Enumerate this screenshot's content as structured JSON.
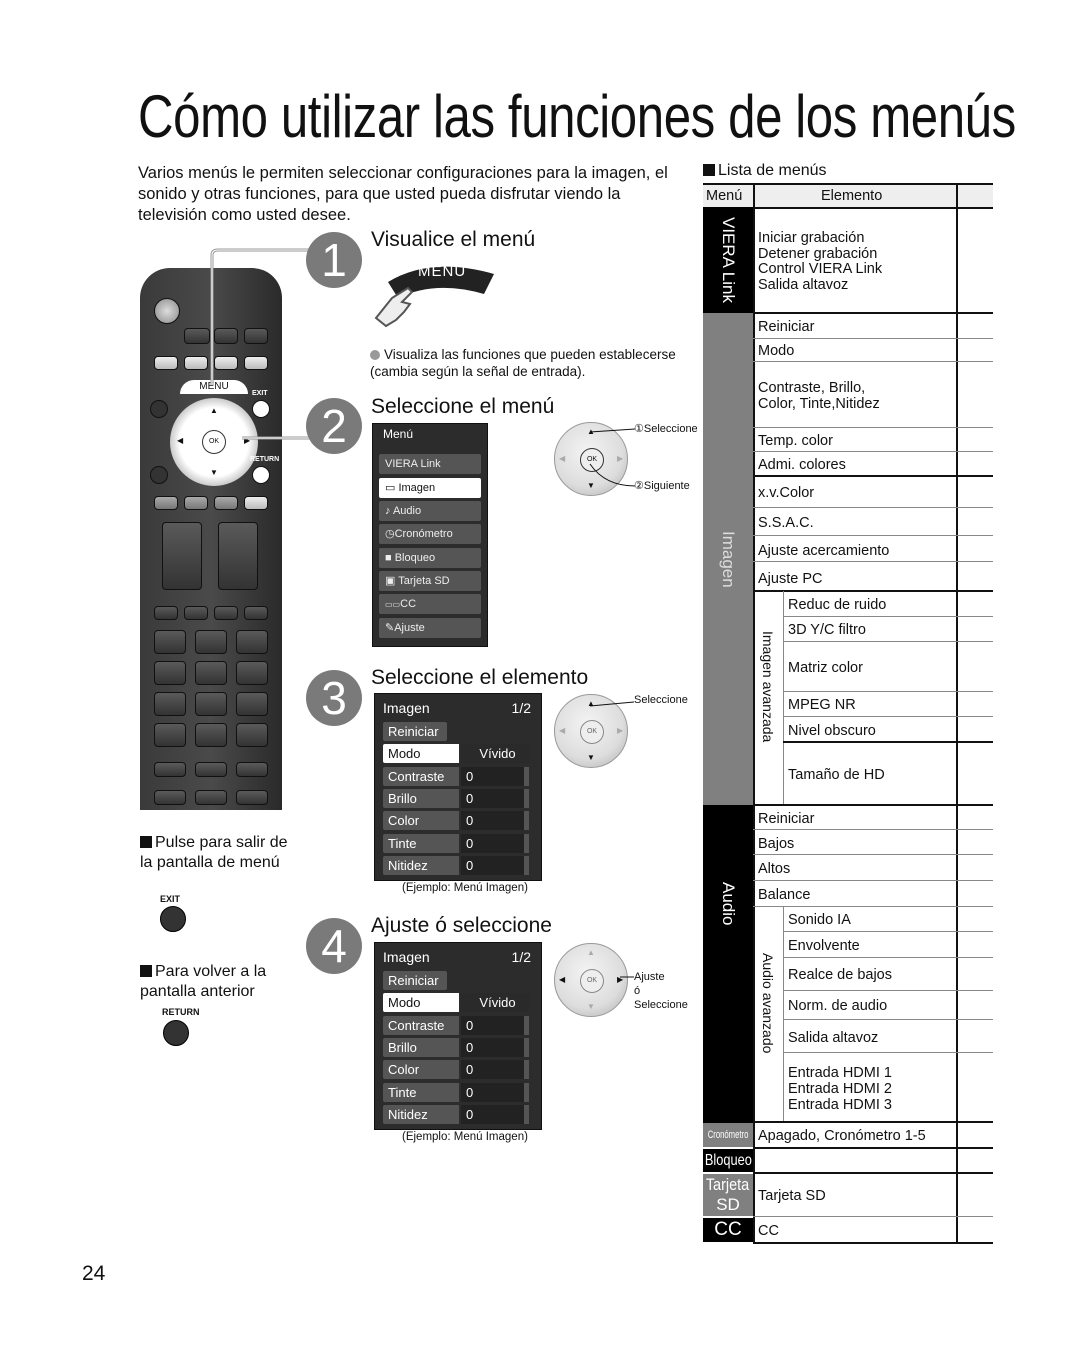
{
  "page": {
    "title": "Cómo utilizar las funciones de los menús",
    "intro": "Varios menús le permiten seleccionar configuraciones para la imagen, el sonido y otras funciones, para que usted pueda disfrutar viendo la televisión como usted desee.",
    "page_number": "24"
  },
  "remote": {
    "menu_label": "MENU",
    "exit_label": "EXIT",
    "return_label": "RETURN",
    "ok_label": "OK",
    "icon": "remote-control-icon"
  },
  "steps": [
    {
      "number": "1",
      "title": "Visualice el menú",
      "button_label": "MENU",
      "note": "Visualiza las funciones que pueden establecerse (cambia según la señal de entrada)."
    },
    {
      "number": "2",
      "title": "Seleccione el menú",
      "menu_header": "Menú",
      "menu_items": [
        {
          "label": "VIERA Link",
          "icon": ""
        },
        {
          "label": "Imagen",
          "icon": "▭",
          "selected": true
        },
        {
          "label": "Audio",
          "icon": "♪"
        },
        {
          "label": "Cronómetro",
          "icon": "◷"
        },
        {
          "label": "Bloqueo",
          "icon": "🔒"
        },
        {
          "label": "Tarjeta SD",
          "icon": "▣"
        },
        {
          "label": "CC",
          "icon": "▭"
        },
        {
          "label": "Ajuste",
          "icon": "✎"
        }
      ],
      "callout_1": "①Seleccione",
      "callout_2": "②Siguiente"
    },
    {
      "number": "3",
      "title": "Seleccione el elemento",
      "callout_1": "Seleccione",
      "caption": "(Ejemplo:  Menú Imagen)"
    },
    {
      "number": "4",
      "title": "Ajuste ó seleccione",
      "callout_1": "Ajuste",
      "callout_2": "ó",
      "callout_3": "Seleccione",
      "caption": "(Ejemplo:  Menú Imagen)"
    }
  ],
  "osd_imagen": {
    "header": "Imagen",
    "page": "1/2",
    "reset": "Reiniciar",
    "rows": [
      {
        "label": "Modo",
        "value": "Vívido",
        "selected": true
      },
      {
        "label": "Contraste",
        "value": "0"
      },
      {
        "label": "Brillo",
        "value": "0"
      },
      {
        "label": "Color",
        "value": "0"
      },
      {
        "label": "Tinte",
        "value": "0"
      },
      {
        "label": "Nitidez",
        "value": "0"
      }
    ]
  },
  "notes": {
    "exit_note": "Pulse para salir de la pantalla de menú",
    "exit_button": "EXIT",
    "return_note": "Para volver a la pantalla anterior",
    "return_button": "RETURN"
  },
  "menu_list": {
    "heading": "Lista de menús",
    "col_menu": "Menú",
    "col_item": "Elemento",
    "groups": {
      "viera": {
        "label": "VIERA Link",
        "items": [
          "Iniciar grabación",
          "Detener grabación",
          "Control VIERA Link",
          "Salida altavoz"
        ]
      },
      "imagen": {
        "label": "Imagen",
        "items": [
          "Reiniciar",
          "Modo",
          "Contraste, Brillo, Color, Tinte,Nitidez",
          "Temp. color",
          "Admi. colores",
          "x.v.Color",
          "S.S.A.C.",
          "Ajuste acercamiento",
          "Ajuste PC"
        ],
        "advanced_label": "Imagen avanzada",
        "advanced_items": [
          "Reduc de ruido",
          "3D Y/C filtro",
          "Matriz color",
          "MPEG NR",
          "Nivel obscuro",
          "Tamaño de HD"
        ]
      },
      "audio": {
        "label": "Audio",
        "items": [
          "Reiniciar",
          "Bajos",
          "Altos",
          "Balance"
        ],
        "advanced_label": "Audio avanzado",
        "advanced_items": [
          "Sonido IA",
          "Envolvente",
          "Realce de bajos",
          "Norm. de audio",
          "Salida altavoz",
          "Entrada HDMI 1\nEntrada HDMI 2\nEntrada HDMI 3"
        ]
      },
      "cronometro": {
        "label": "Cronómetro",
        "items": [
          "Apagado, Cronómetro 1-5"
        ]
      },
      "bloqueo": {
        "label": "Bloqueo",
        "items": [
          ""
        ]
      },
      "tarjeta": {
        "label": "Tarjeta SD",
        "label_1": "Tarjeta",
        "label_2": "SD",
        "items": [
          "Tarjeta SD"
        ]
      },
      "cc": {
        "label": "CC",
        "items": [
          "CC"
        ]
      }
    }
  },
  "colors": {
    "black_band": "#000000",
    "gray_band": "#808080",
    "osd_bg": "#2c2c2c",
    "step_circle": "#7a7a7a"
  }
}
